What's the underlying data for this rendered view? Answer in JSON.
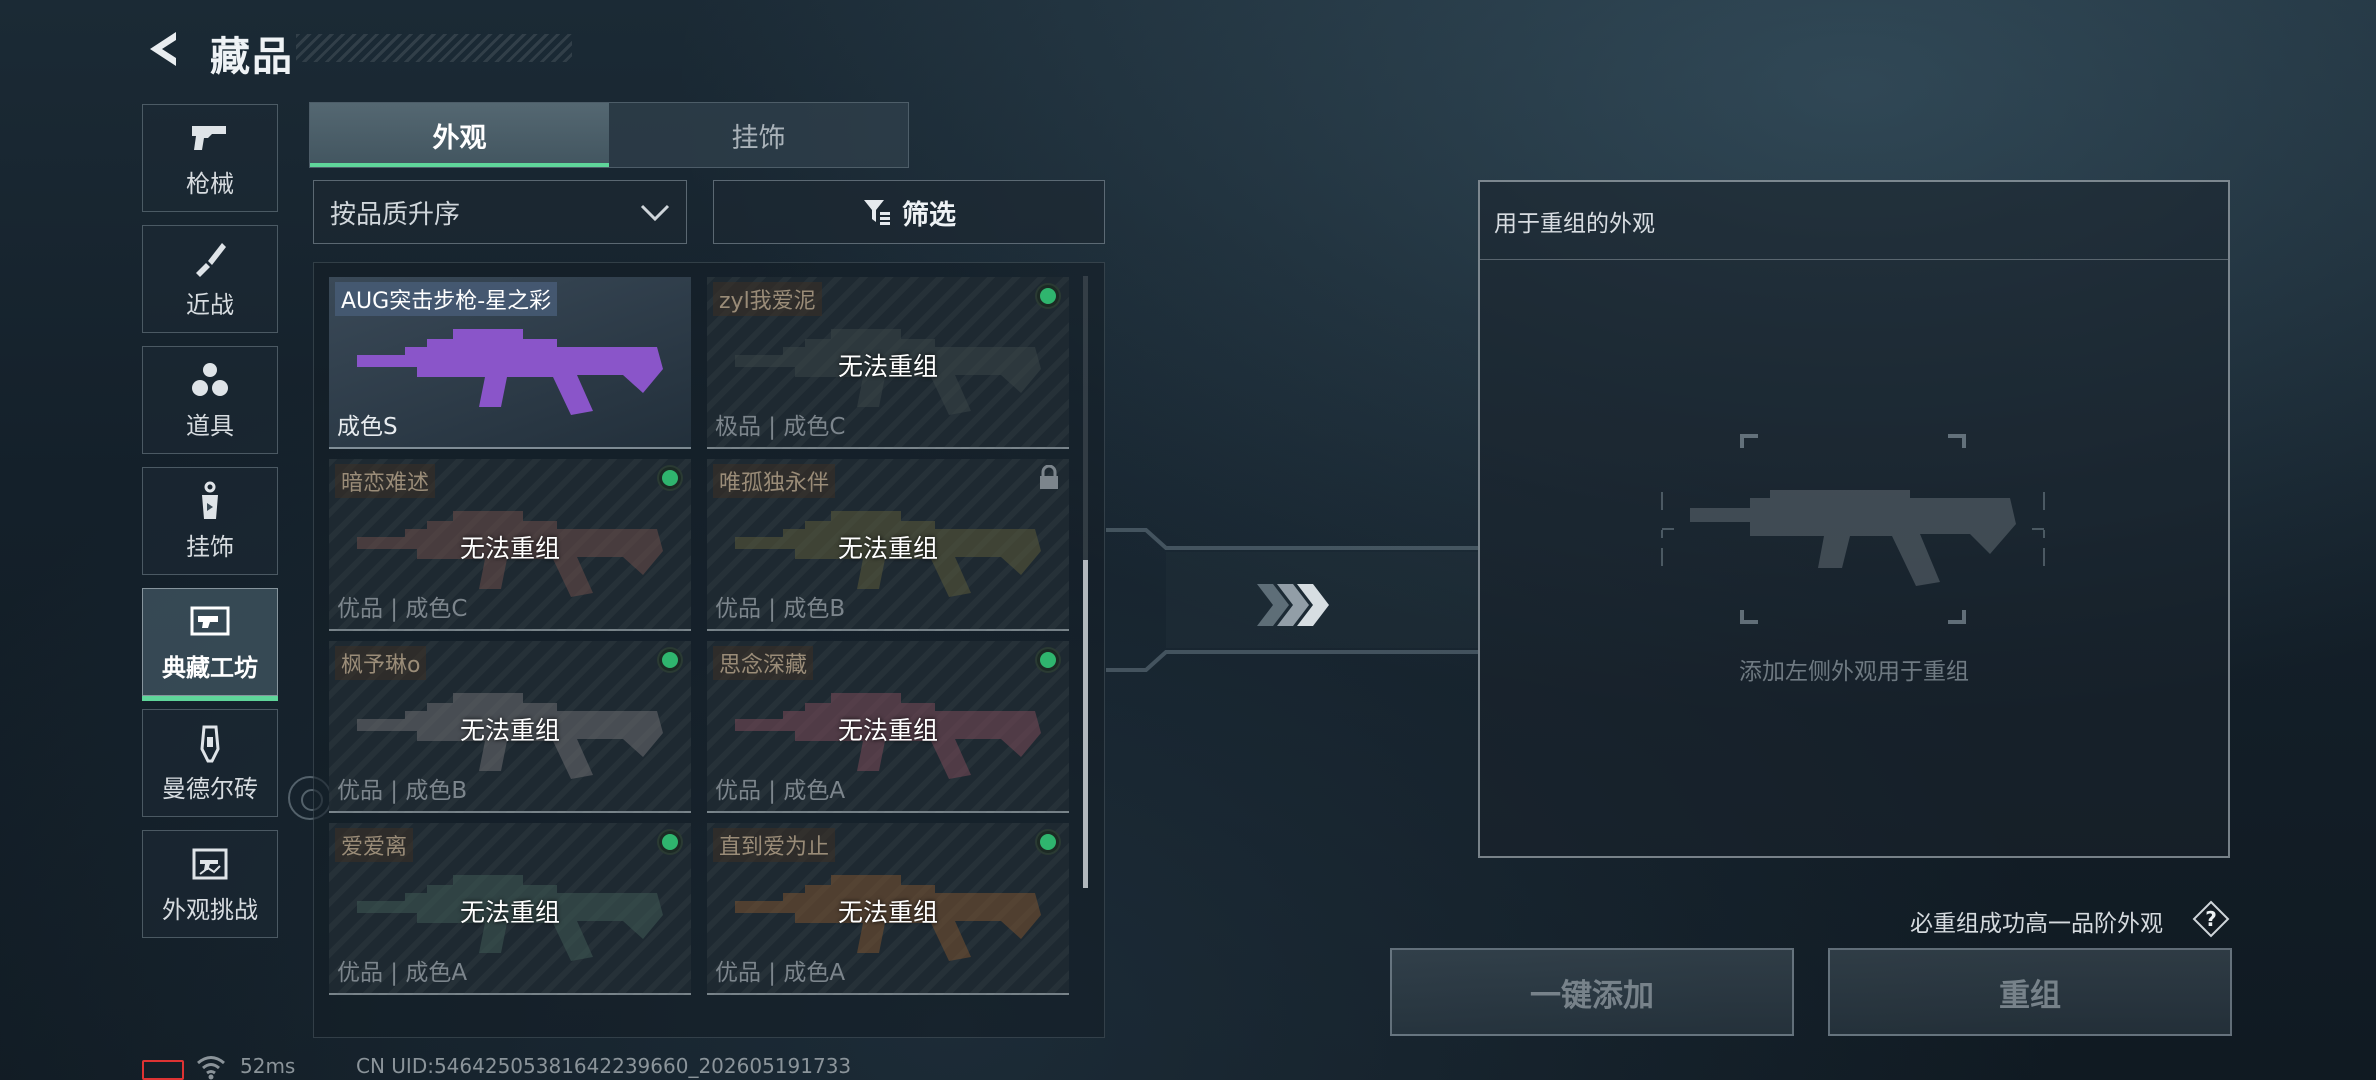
{
  "header": {
    "title": "藏品"
  },
  "nav": [
    {
      "label": "枪械",
      "icon": "pistol-icon"
    },
    {
      "label": "近战",
      "icon": "knife-icon"
    },
    {
      "label": "道具",
      "icon": "grenades-icon"
    },
    {
      "label": "挂饰",
      "icon": "charm-icon"
    },
    {
      "label": "典藏工坊",
      "icon": "workshop-icon",
      "active": true
    },
    {
      "label": "曼德尔砖",
      "icon": "brick-icon"
    },
    {
      "label": "外观挑战",
      "icon": "challenge-icon"
    }
  ],
  "tabs": [
    {
      "label": "外观",
      "active": true
    },
    {
      "label": "挂饰",
      "active": false
    }
  ],
  "sort": {
    "value": "按品质升序"
  },
  "filter": {
    "label": "筛选"
  },
  "cards": [
    {
      "name": "AUG突击步枪-星之彩",
      "status": "",
      "grade": "成色S",
      "selected": true,
      "marker": "none",
      "tint": "#8a55c9"
    },
    {
      "name": "zyl我爱泥",
      "status": "无法重组",
      "grade": "极品 | 成色C",
      "selected": false,
      "marker": "dot",
      "tint": "#3b4548"
    },
    {
      "name": "暗恋难述",
      "status": "无法重组",
      "grade": "优品 | 成色C",
      "selected": false,
      "marker": "dot",
      "tint": "#6b4d4a"
    },
    {
      "name": "唯孤独永伴",
      "status": "无法重组",
      "grade": "优品 | 成色B",
      "selected": false,
      "marker": "lock",
      "tint": "#5a5a3a"
    },
    {
      "name": "枫予琳o",
      "status": "无法重组",
      "grade": "优品 | 成色B",
      "selected": false,
      "marker": "dot",
      "tint": "#6c6c70"
    },
    {
      "name": "思念深藏",
      "status": "无法重组",
      "grade": "优品 | 成色A",
      "selected": false,
      "marker": "dot",
      "tint": "#7a4a58"
    },
    {
      "name": "爱爱离",
      "status": "无法重组",
      "grade": "优品 | 成色A",
      "selected": false,
      "marker": "dot",
      "tint": "#3f5a54"
    },
    {
      "name": "直到爱为止",
      "status": "无法重组",
      "grade": "优品 | 成色A",
      "selected": false,
      "marker": "dot",
      "tint": "#7a5230"
    }
  ],
  "recombine": {
    "header": "用于重组的外观",
    "hint": "添加左侧外观用于重组",
    "guarantee": "必重组成功高一品阶外观",
    "help_label": "?",
    "add_all_label": "一键添加",
    "recombine_label": "重组"
  },
  "status_bar": {
    "ping": "52ms",
    "uid": "CN UID:5464250538164223966​0_202605191733"
  },
  "colors": {
    "accent": "#5fd59a",
    "marker": "#2fb56e"
  }
}
